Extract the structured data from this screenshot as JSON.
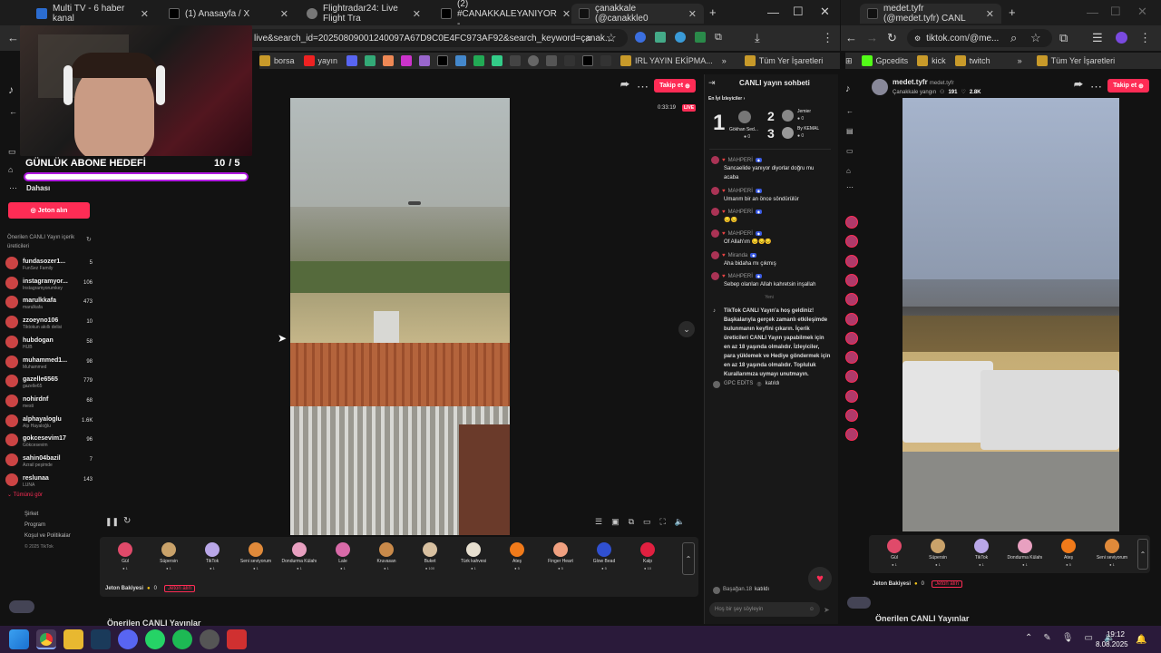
{
  "window1": {
    "tabs": [
      "Multi TV - 6 haber kanal",
      "(1) Anasayfa / X",
      "Flightradar24: Live Flight Tra",
      "(2) #CANAKKALEYANIYOR -",
      "çanakkale (@canakkle0"
    ],
    "url": "live&search_id=20250809001240097A67D9C0E4FC973AF92&search_keyword=çanak...",
    "bookmarks": [
      "borsa",
      "yayın",
      "IRL YAYIN EKİPMA...",
      "Tüm Yer İşaretleri"
    ],
    "goal_title": "GÜNLÜK ABONE HEDEFİ",
    "goal_count": "10",
    "goal_target": "/ 5",
    "more": "Dahası",
    "jeton_button": "Jeton alın",
    "suggested_title": "Önerilen CANLI Yayın içerik üreticileri",
    "creators": [
      {
        "name": "fundasozer1...",
        "sub": "FunSez Family",
        "count": "5"
      },
      {
        "name": "instagramyor...",
        "sub": "İnstagramyorumkey",
        "count": "106"
      },
      {
        "name": "marulkkafa",
        "sub": "marulkafa",
        "count": "473"
      },
      {
        "name": "zzoeyno106",
        "sub": "Tiktokun akıllı delisi",
        "count": "10"
      },
      {
        "name": "hubdogan",
        "sub": "HUB",
        "count": "58"
      },
      {
        "name": "muhammed1...",
        "sub": "Muhammed",
        "count": "98"
      },
      {
        "name": "gazelle6565",
        "sub": "gazelle65",
        "count": "779"
      },
      {
        "name": "nohirdnf",
        "sub": "mesti",
        "count": "68"
      },
      {
        "name": "alphayaloglu",
        "sub": "Alp Hayaloğlu",
        "count": "1.6K"
      },
      {
        "name": "gokcesevim17",
        "sub": "Gökcesevim",
        "count": "96"
      },
      {
        "name": "sahin04bazil",
        "sub": "Azrail peşimde",
        "count": "7"
      },
      {
        "name": "reslunaa",
        "sub": "LUNA",
        "count": "143"
      }
    ],
    "see_all": "Tümünü gör",
    "footer_links": [
      "Şirket",
      "Program",
      "Koşul ve Politikalar",
      "© 2025 TikTok"
    ],
    "follow": "Takip et",
    "live_time": "0:33:19",
    "live_badge": "LIVE",
    "gifts": [
      {
        "name": "Gül",
        "price": "1",
        "color": "#e04a6a"
      },
      {
        "name": "Süpersin",
        "price": "1",
        "color": "#c9a26a"
      },
      {
        "name": "TikTok",
        "price": "1",
        "color": "#b9a7e8"
      },
      {
        "name": "Seni seviyorum",
        "price": "1",
        "color": "#e08a3a"
      },
      {
        "name": "Dondurma Külahı",
        "price": "1",
        "color": "#e8a0c0"
      },
      {
        "name": "Lale",
        "price": "1",
        "color": "#d86aa8"
      },
      {
        "name": "Kruvasan",
        "price": "1",
        "color": "#c98a4a"
      },
      {
        "name": "Buket",
        "price": "100",
        "color": "#d8c0a0"
      },
      {
        "name": "Türk kahvesi",
        "price": "1",
        "color": "#e8e0d0"
      },
      {
        "name": "Ateş",
        "price": "5",
        "color": "#f07a1a"
      },
      {
        "name": "Finger Heart",
        "price": "5",
        "color": "#f0a080"
      },
      {
        "name": "Glow Bead",
        "price": "5",
        "color": "#3050d0"
      },
      {
        "name": "Kalp",
        "price": "10",
        "color": "#e02040"
      }
    ],
    "jeton_balance": "Jeton Bakiyesi",
    "jeton_value": "0",
    "jeton_get": "Jeton alın",
    "suggested_live": "Önerilen CANLI Yayınlar",
    "chat_title": "CANLI yayın sohbeti",
    "top_title": "En İyi İzleyiciler",
    "top": [
      {
        "rank": "1",
        "name": "Gökhan Sed...",
        "score": "0"
      },
      {
        "rank": "2",
        "name": "Jemier",
        "score": "0"
      },
      {
        "rank": "3",
        "name": "By KEMAL",
        "score": "0"
      }
    ],
    "messages": [
      {
        "user": "MAHPERİ",
        "text": "Sancaelide yanıyor diyorlar doğru mu acaba"
      },
      {
        "user": "MAHPERİ",
        "text": "Umarım bir an önce söndürülür"
      },
      {
        "user": "MAHPERİ",
        "text": "😔😔"
      },
      {
        "user": "MAHPERİ",
        "text": "Of Allah'ım 😔😔😔"
      },
      {
        "user": "Miranda",
        "text": "Aha bidaha mı çıkmış"
      },
      {
        "user": "MAHPERİ",
        "text": "Sebep olanları Allah kahretsin inşallah"
      }
    ],
    "new_label": "Yeni",
    "system_msg": "TikTok CANLI Yayın'a hoş geldiniz! Başkalarıyla gerçek zamanlı etkileşimde bulunmanın keyfini çıkarın. İçerik üreticileri CANLI Yayın yapabilmek için en az 18 yaşında olmalıdır. İzleyiciler, para yüklemek ve Hediye göndermek için en az 18 yaşında olmalıdır. Topluluk Kurallarımıza uymayı unutmayın.",
    "joined_user": "GPC EDİTS",
    "joined_text": "katıldı",
    "bottom_joined_user": "Başağan.18",
    "bottom_joined_text": "katıldı",
    "chat_placeholder": "Hoş bir şey söyleyin"
  },
  "window2": {
    "tab": "medet.tyfr (@medet.tyfr) CANL",
    "url": "tiktok.com/@me...",
    "bookmarks": [
      "Gpcedits",
      "kick",
      "twitch",
      "Tüm Yer İşaretleri"
    ],
    "streamer": "medet.tyfr",
    "streamer_handle": "medet.tyfr",
    "subtitle": "Çanakkale yangın",
    "viewers": "191",
    "likes": "2.8K",
    "follow": "Takip et",
    "gifts": [
      {
        "name": "Gül",
        "price": "1",
        "color": "#e04a6a"
      },
      {
        "name": "Süpersin",
        "price": "1",
        "color": "#c9a26a"
      },
      {
        "name": "TikTok",
        "price": "1",
        "color": "#b9a7e8"
      },
      {
        "name": "Dondurma Külahı",
        "price": "1",
        "color": "#e8a0c0"
      },
      {
        "name": "Ateş",
        "price": "5",
        "color": "#f07a1a"
      },
      {
        "name": "Seni seviyorum",
        "price": "1",
        "color": "#e08a3a"
      }
    ],
    "jeton_balance": "Jeton Bakiyesi",
    "jeton_value": "0",
    "jeton_get": "Jeton alın",
    "suggested_live": "Önerilen CANLI Yayınlar"
  },
  "taskbar": {
    "time": "19:12",
    "date": "8.08.2025"
  }
}
